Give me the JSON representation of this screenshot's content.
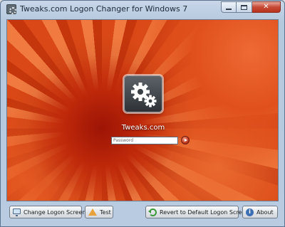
{
  "window": {
    "title": "Tweaks.com Logon Changer for Windows 7",
    "caption": {
      "minimize": "",
      "maximize": "",
      "close": "✕"
    }
  },
  "preview": {
    "background": "orange chrysanthemum flower",
    "user_name": "Tweaks.com",
    "password_placeholder": "Password",
    "accent_color": "#e2531e"
  },
  "toolbar": {
    "change_logon_screen": {
      "label": "Change Logon Screen",
      "icon": "monitor-icon"
    },
    "test": {
      "label": "Test",
      "icon": "warning-icon"
    },
    "revert": {
      "label": "Revert to Default Logon Screen",
      "icon": "revert-icon"
    },
    "about": {
      "label": "About",
      "icon": "info-icon",
      "glyph": "i"
    }
  }
}
